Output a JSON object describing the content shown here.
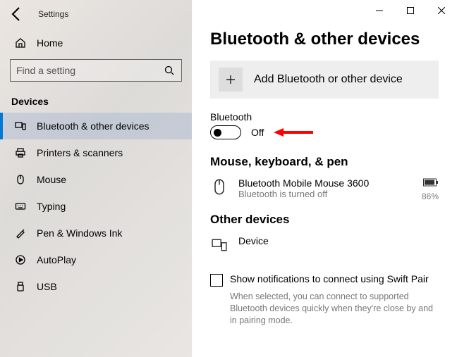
{
  "app": {
    "title": "Settings"
  },
  "sidebar": {
    "home": "Home",
    "search_placeholder": "Find a setting",
    "section": "Devices",
    "items": [
      {
        "label": "Bluetooth & other devices"
      },
      {
        "label": "Printers & scanners"
      },
      {
        "label": "Mouse"
      },
      {
        "label": "Typing"
      },
      {
        "label": "Pen & Windows Ink"
      },
      {
        "label": "AutoPlay"
      },
      {
        "label": "USB"
      }
    ]
  },
  "page": {
    "title": "Bluetooth & other devices",
    "add_device": "Add Bluetooth or other device",
    "bluetooth_label": "Bluetooth",
    "bluetooth_state": "Off",
    "groups": {
      "mouse": {
        "title": "Mouse, keyboard, & pen",
        "device_name": "Bluetooth Mobile Mouse 3600",
        "device_status": "Bluetooth is turned off",
        "battery_pct": "86%"
      },
      "other": {
        "title": "Other devices",
        "device_name": "Device"
      }
    },
    "swift_pair": {
      "label": "Show notifications to connect using Swift Pair",
      "desc": "When selected, you can connect to supported Bluetooth devices quickly when they're close by and in pairing mode."
    }
  }
}
